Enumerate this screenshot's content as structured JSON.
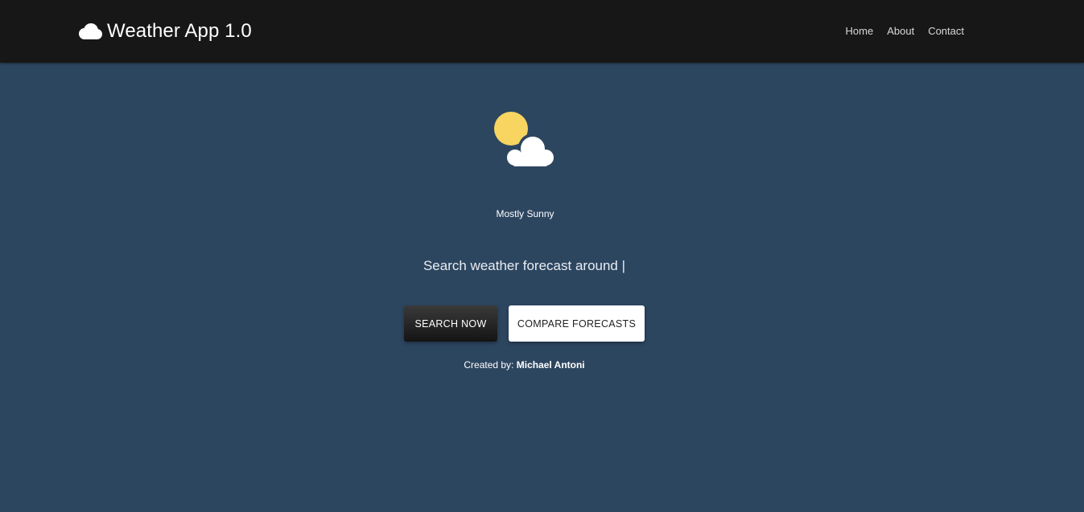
{
  "header": {
    "brand_icon": "cloud-icon",
    "brand_title": "Weather App 1.0",
    "nav": [
      {
        "label": "Home"
      },
      {
        "label": "About"
      },
      {
        "label": "Contact"
      }
    ]
  },
  "hero": {
    "weather_icon": "partly-sunny-icon",
    "condition": "Mostly Sunny",
    "tagline": "Search weather forecast around |",
    "buttons": {
      "search_label": "SEARCH NOW",
      "compare_label": "COMPARE FORECASTS"
    },
    "credits": {
      "prefix": "Created by:",
      "author": "Michael Antoni"
    }
  },
  "colors": {
    "background": "#2d4660",
    "navbar": "#171717",
    "sun": "#f7d560",
    "cloud": "#ffffff"
  }
}
